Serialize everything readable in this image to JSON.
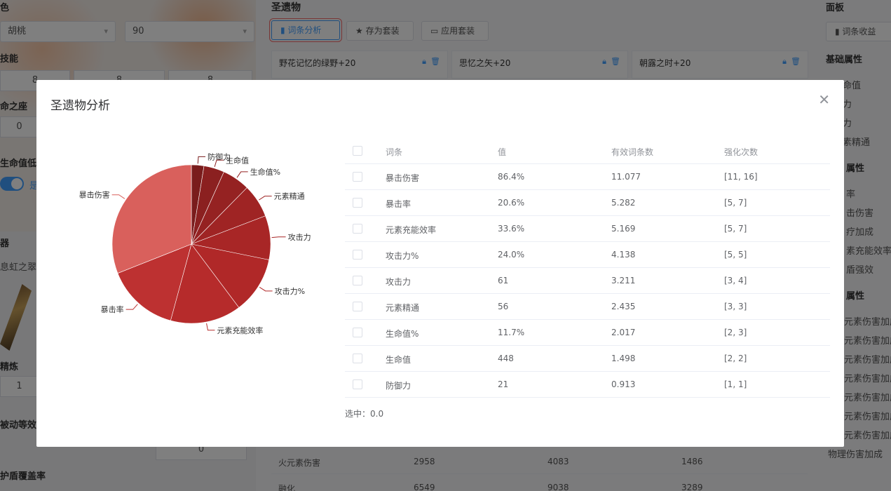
{
  "left": {
    "role_label": "色",
    "role_value": "胡桃",
    "level_value": "90",
    "talent_label": "技能",
    "talent_values": [
      "8",
      "8",
      "8"
    ],
    "constellation_label": "命之座",
    "constellation_value": "0",
    "hp_condition_label": "生命值低于",
    "hp_condition_option": "是",
    "weapon_label": "器",
    "weapon_value": "息虹之翠",
    "refine_label": "精炼",
    "refine_value": "1",
    "stack_label": "被动等效层",
    "stack_value": "0",
    "shield_label": "护盾覆盖率"
  },
  "middle": {
    "title": "圣遗物",
    "buttons": {
      "analysis": "词条分析",
      "save_set": "存为套装",
      "apply_set": "应用套装"
    },
    "artifact_cards": [
      "野花记忆的绿野+20",
      "思忆之矢+20",
      "朝露之时+20"
    ],
    "bottom_rows": [
      [
        "火元素伤害",
        "2958",
        "4083",
        "1486"
      ],
      [
        "融化",
        "6549",
        "9038",
        "3289"
      ]
    ]
  },
  "right": {
    "title": "面板",
    "button": "词条收益",
    "basic_title": "基础属性",
    "basic_items": [
      "命值",
      "力",
      "力",
      "素精通"
    ],
    "adv_title": "属性",
    "adv_items": [
      "率",
      "击伤害",
      "疗加成",
      "素充能效率",
      "盾强效"
    ],
    "elem_title": "属性",
    "elem_items": [
      "元素伤害加成",
      "元素伤害加成",
      "元素伤害加成",
      "元素伤害加成",
      "元素伤害加成",
      "元素伤害加成",
      "元素伤害加成"
    ],
    "physical": "物理伤害加成"
  },
  "modal": {
    "title": "圣遗物分析",
    "table": {
      "headers": [
        "词条",
        "值",
        "有效词条数",
        "强化次数"
      ],
      "rows": [
        [
          "暴击伤害",
          "86.4%",
          "11.077",
          "[11, 16]"
        ],
        [
          "暴击率",
          "20.6%",
          "5.282",
          "[5, 7]"
        ],
        [
          "元素充能效率",
          "33.6%",
          "5.169",
          "[5, 7]"
        ],
        [
          "攻击力%",
          "24.0%",
          "4.138",
          "[5, 5]"
        ],
        [
          "攻击力",
          "61",
          "3.211",
          "[3, 4]"
        ],
        [
          "元素精通",
          "56",
          "2.435",
          "[3, 3]"
        ],
        [
          "生命值%",
          "11.7%",
          "2.017",
          "[2, 3]"
        ],
        [
          "生命值",
          "448",
          "1.498",
          "[2, 2]"
        ],
        [
          "防御力",
          "21",
          "0.913",
          "[1, 1]"
        ]
      ]
    },
    "selected_text": "选中：0.0"
  },
  "chart_data": {
    "type": "pie",
    "categories": [
      "防御力",
      "生命值",
      "生命值%",
      "元素精通",
      "攻击力",
      "攻击力%",
      "元素充能效率",
      "暴击率",
      "暴击伤害"
    ],
    "values": [
      0.913,
      1.498,
      2.017,
      2.435,
      3.211,
      4.138,
      5.169,
      5.282,
      11.077
    ],
    "colors": [
      "#7a1c1c",
      "#8b2020",
      "#952222",
      "#9f2424",
      "#a82626",
      "#b02828",
      "#b62b2b",
      "#bd3131",
      "#d9605c"
    ]
  }
}
